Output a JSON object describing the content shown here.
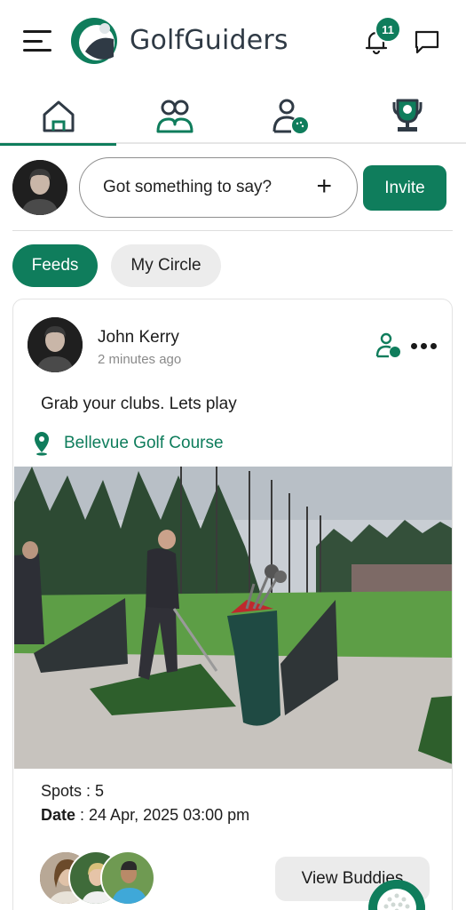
{
  "app": {
    "brand": "GolfGuiders",
    "notification_count": "11"
  },
  "icons": {
    "menu": "hamburger-icon",
    "bell": "bell-icon",
    "chat": "chat-icon",
    "home": "home-icon",
    "friends": "friends-icon",
    "golfer": "golfer-icon",
    "trophy": "trophy-icon",
    "location": "location-pin-icon",
    "more": "more-horizontal-icon"
  },
  "composer": {
    "placeholder": "Got something to say?",
    "plus": "+",
    "invite_label": "Invite"
  },
  "filters": {
    "feeds": "Feeds",
    "my_circle": "My Circle",
    "active": "Feeds"
  },
  "post": {
    "author": "John Kerry",
    "time": "2 minutes ago",
    "text": "Grab your clubs. Lets play",
    "location": "Bellevue Golf Course",
    "spots_label": "Spots",
    "spots_value": "5",
    "date_label": "Date",
    "date_value": "24 Apr, 2025 03:00 pm",
    "view_buddies_label": "View Buddies"
  },
  "colors": {
    "accent": "#0f7d5c",
    "text": "#1c1c1c",
    "muted": "#8a8a8a",
    "pill_bg": "#ececec"
  }
}
